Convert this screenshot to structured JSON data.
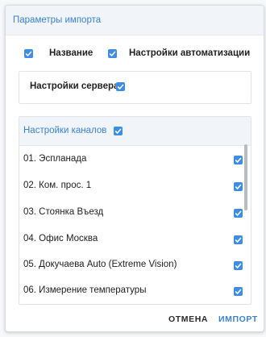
{
  "dialog": {
    "title": "Параметры импорта",
    "options": {
      "name_label": "Название",
      "name_checked": true,
      "automation_label": "Настройки автоматизации",
      "automation_checked": true
    },
    "server": {
      "label": "Настройки сервера",
      "checked": true
    },
    "channels": {
      "title": "Настройки каналов",
      "checked": true,
      "items": [
        {
          "label": "01. Эспланада",
          "checked": true
        },
        {
          "label": "02. Ком. прос. 1",
          "checked": true
        },
        {
          "label": "03. Стоянка Въезд",
          "checked": true
        },
        {
          "label": "04. Офис Москва",
          "checked": true
        },
        {
          "label": "05. Докучаева Auto (Extreme Vision)",
          "checked": true
        },
        {
          "label": "06. Измерение температуры",
          "checked": true
        }
      ]
    },
    "buttons": {
      "cancel": "ОТМЕНА",
      "import": "ИМПОРТ"
    },
    "colors": {
      "accent": "#3b8de8",
      "header_bg": "#f1f4f9",
      "link_text": "#3b82d6"
    }
  }
}
